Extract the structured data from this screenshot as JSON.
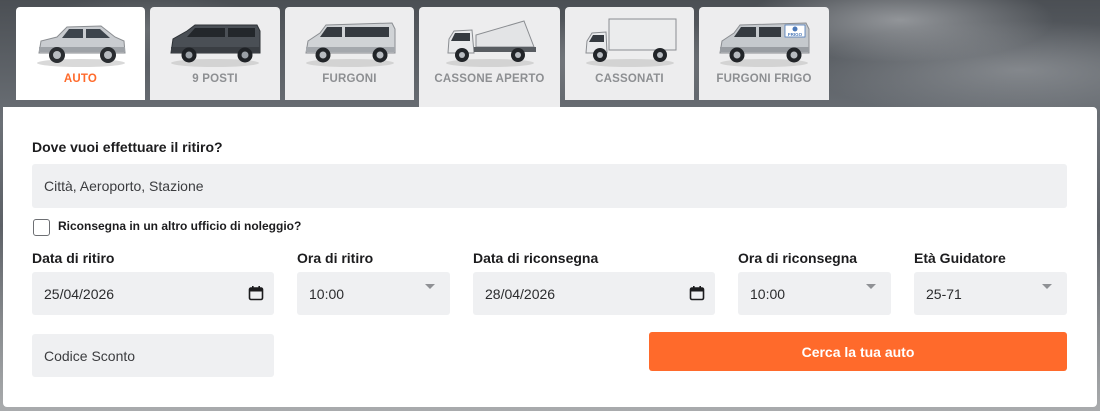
{
  "tabs": [
    {
      "label": "AUTO",
      "icon": "car-suv-icon",
      "active": true
    },
    {
      "label": "9 POSTI",
      "icon": "minibus-icon",
      "active": false
    },
    {
      "label": "FURGONI",
      "icon": "van-icon",
      "active": false
    },
    {
      "label": "CASSONE APERTO",
      "icon": "tipper-truck-icon",
      "active": false
    },
    {
      "label": "CASSONATI",
      "icon": "box-truck-icon",
      "active": false
    },
    {
      "label": "FURGONI FRIGO",
      "icon": "refrigerated-van-icon",
      "active": false
    }
  ],
  "tab_badge": "FRIGO",
  "form": {
    "pickup_question": "Dove vuoi effettuare il ritiro?",
    "pickup_placeholder": "Città, Aeroporto, Stazione",
    "return_other_label": "Riconsegna in un altro ufficio di noleggio?",
    "pickup_date_label": "Data di ritiro",
    "pickup_date_value": "25/04/2026",
    "pickup_time_label": "Ora di ritiro",
    "pickup_time_value": "10:00",
    "return_date_label": "Data di riconsegna",
    "return_date_value": "28/04/2026",
    "return_time_label": "Ora di riconsegna",
    "return_time_value": "10:00",
    "driver_age_label": "Età Guidatore",
    "driver_age_value": "25-71",
    "discount_placeholder": "Codice Sconto",
    "submit_label": "Cerca la tua auto"
  },
  "colors": {
    "accent": "#ff6a2b",
    "field_bg": "#eff0f2",
    "tab_bg": "#ededee"
  }
}
